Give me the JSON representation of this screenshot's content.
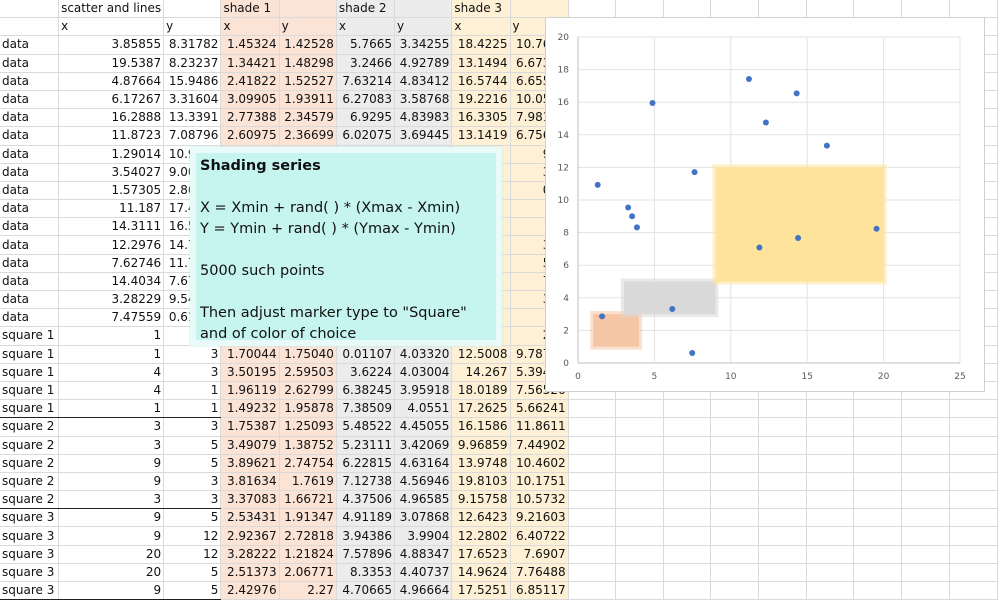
{
  "headers": {
    "top": [
      "",
      "scatter and lines",
      "",
      "shade 1",
      "",
      "shade 2",
      "",
      "shade 3",
      ""
    ],
    "sub": [
      "",
      "x",
      "y",
      "x",
      "y",
      "x",
      "y",
      "x",
      "y"
    ]
  },
  "rows": [
    [
      "data",
      "3.85855",
      "8.31782",
      "1.45324",
      "1.42528",
      "5.7665",
      "3.34255",
      "18.4225",
      "10.7691"
    ],
    [
      "data",
      "19.5387",
      "8.23237",
      "1.34421",
      "1.48298",
      "3.2466",
      "4.92789",
      "13.1494",
      "6.67359"
    ],
    [
      "data",
      "4.87664",
      "15.9486",
      "2.41822",
      "1.52527",
      "7.63214",
      "4.83412",
      "16.5744",
      "6.65528"
    ],
    [
      "data",
      "6.17267",
      "3.31604",
      "3.09905",
      "1.93911",
      "6.27083",
      "3.58768",
      "19.2216",
      "10.0583"
    ],
    [
      "data",
      "16.2888",
      "13.3391",
      "2.77388",
      "2.34579",
      "6.9295",
      "4.83983",
      "16.3305",
      "7.98122"
    ],
    [
      "data",
      "11.8723",
      "7.08796",
      "2.60975",
      "2.36699",
      "6.02075",
      "3.69445",
      "13.1419",
      "6.75688"
    ],
    [
      "data",
      "1.29014",
      "10.9275",
      "",
      "",
      "",
      "",
      "",
      "975"
    ],
    [
      "data",
      "3.54027",
      "9.00495",
      "2",
      "",
      "",
      "",
      "",
      "302"
    ],
    [
      "data",
      "1.57305",
      "2.86306",
      "1",
      "",
      "",
      "",
      "",
      "086"
    ],
    [
      "data",
      "11.187",
      "17.4203",
      "2",
      "",
      "",
      "",
      "",
      "76"
    ],
    [
      "data",
      "14.3111",
      "16.5383",
      "",
      "",
      "",
      "",
      "",
      "97"
    ],
    [
      "data",
      "12.2976",
      "14.7582",
      "1",
      "",
      "",
      "",
      "",
      "302"
    ],
    [
      "data",
      "7.62746",
      "11.7072",
      "1",
      "",
      "",
      "",
      "",
      "538"
    ],
    [
      "data",
      "14.4034",
      "7.67205",
      "",
      "",
      "",
      "",
      "",
      "791"
    ],
    [
      "data",
      "3.28229",
      "9.54263",
      "3",
      "",
      "",
      "",
      "",
      "389"
    ],
    [
      "data",
      "7.47559",
      "0.61403",
      "2",
      "",
      "",
      "",
      "",
      "48"
    ],
    [
      "square 1",
      "1",
      "1",
      "2",
      "",
      "",
      "",
      "",
      "234"
    ],
    [
      "square 1",
      "1",
      "3",
      "1.70044",
      "1.75040",
      "0.01107",
      "4.03320",
      "12.5008",
      "9.78769"
    ],
    [
      "square 1",
      "4",
      "3",
      "3.50195",
      "2.59503",
      "3.6224",
      "4.03004",
      "14.267",
      "5.39417"
    ],
    [
      "square 1",
      "4",
      "1",
      "1.96119",
      "2.62799",
      "6.38245",
      "3.95918",
      "18.0189",
      "7.56526"
    ],
    [
      "square 1",
      "1",
      "1",
      "1.49232",
      "1.95878",
      "7.38509",
      "4.0551",
      "17.2625",
      "5.66241"
    ],
    [
      "square 2",
      "3",
      "3",
      "1.75387",
      "1.25093",
      "5.48522",
      "4.45055",
      "16.1586",
      "11.8611"
    ],
    [
      "square 2",
      "3",
      "5",
      "3.49079",
      "1.38752",
      "5.23111",
      "3.42069",
      "9.96859",
      "7.44902"
    ],
    [
      "square 2",
      "9",
      "5",
      "3.89621",
      "2.74754",
      "6.22815",
      "4.63164",
      "13.9748",
      "10.4602"
    ],
    [
      "square 2",
      "9",
      "3",
      "3.81634",
      "1.7619",
      "7.12738",
      "4.56946",
      "19.8103",
      "10.1751"
    ],
    [
      "square 2",
      "3",
      "3",
      "3.37083",
      "1.66721",
      "4.37506",
      "4.96585",
      "9.15758",
      "10.5732"
    ],
    [
      "square 3",
      "9",
      "5",
      "2.53431",
      "1.91347",
      "4.91189",
      "3.07868",
      "12.6423",
      "9.21603"
    ],
    [
      "square 3",
      "9",
      "12",
      "2.92367",
      "2.72818",
      "3.94386",
      "3.9904",
      "12.2802",
      "6.40722"
    ],
    [
      "square 3",
      "20",
      "12",
      "3.28222",
      "1.21824",
      "7.57896",
      "4.88347",
      "17.6523",
      "7.6907"
    ],
    [
      "square 3",
      "20",
      "5",
      "2.51373",
      "2.06771",
      "8.3353",
      "4.40737",
      "14.9624",
      "7.76488"
    ],
    [
      "square 3",
      "9",
      "5",
      "2.42976",
      "2.27",
      "4.70665",
      "4.96664",
      "17.5251",
      "6.85117"
    ]
  ],
  "note": {
    "title": "Shading series",
    "line1": "X = Xmin + rand( ) * (Xmax - Xmin)",
    "line2": "Y = Ymin + rand( ) * (Ymax - Ymin)",
    "line3": "5000 such points",
    "line4": "Then adjust marker type to \"Square\"",
    "line5": "and of color of choice"
  },
  "chart_data": {
    "type": "scatter",
    "xlim": [
      0,
      25
    ],
    "ylim": [
      0,
      20
    ],
    "x_ticks": [
      "0",
      "5",
      "10",
      "15",
      "20",
      "25"
    ],
    "y_ticks": [
      "0",
      "2",
      "4",
      "6",
      "8",
      "10",
      "12",
      "14",
      "16",
      "18",
      "20"
    ],
    "grid": true,
    "points": {
      "x": [
        3.85855,
        19.5387,
        4.87664,
        6.17267,
        16.2888,
        11.8723,
        1.29014,
        3.54027,
        1.57305,
        11.187,
        14.3111,
        12.2976,
        7.62746,
        14.4034,
        3.28229,
        7.47559
      ],
      "y": [
        8.31782,
        8.23237,
        15.9486,
        3.31604,
        13.3391,
        7.08796,
        10.9275,
        9.00495,
        2.86306,
        17.4203,
        16.5383,
        14.7582,
        11.7072,
        7.67205,
        9.54263,
        0.61403
      ]
    },
    "shaded_regions": [
      {
        "name": "shade 1",
        "xmin": 1,
        "xmax": 4,
        "ymin": 1,
        "ymax": 3,
        "color": "#f5c6a5"
      },
      {
        "name": "shade 2",
        "xmin": 3,
        "xmax": 9,
        "ymin": 3,
        "ymax": 5,
        "color": "#d9d9d9"
      },
      {
        "name": "shade 3",
        "xmin": 9,
        "xmax": 20,
        "ymin": 5,
        "ymax": 12,
        "color": "#fde49a"
      }
    ],
    "marker_color": "#4472c4"
  },
  "colors": {
    "shade1_cells": "#fbe3d6",
    "shade2_cells": "#ececec",
    "shade3_cells": "#fdf0d5",
    "note_bg": "#c6f5f0"
  }
}
